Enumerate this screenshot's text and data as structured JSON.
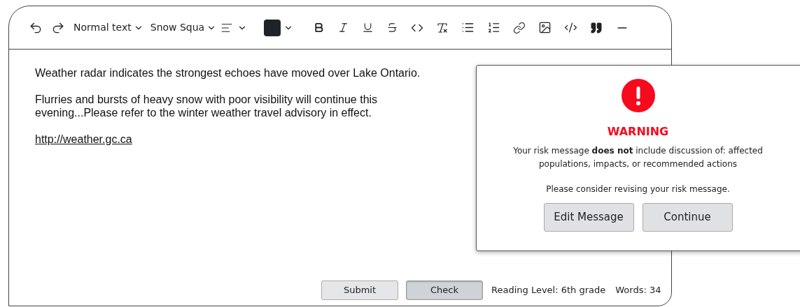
{
  "toolbar": {
    "style_select": "Normal text",
    "font_select": "Snow Squa",
    "color": "#1f2328"
  },
  "editor": {
    "paragraphs": [
      "Weather radar indicates the strongest echoes have moved over Lake Ontario.",
      "Flurries and bursts of heavy snow with poor visibility will continue this evening...Please refer to the winter weather travel advisory in effect."
    ],
    "link": "http://weather.gc.ca"
  },
  "footer": {
    "buttons": [
      {
        "label": "Submit",
        "pressed": false
      },
      {
        "label": "Check",
        "pressed": true
      }
    ],
    "reading_level": "Reading Level: 6th grade",
    "word_count": "Words: 34"
  },
  "dialog": {
    "title": "WARNING",
    "message": "Your risk message **does not** include discussion of: affected populations, impacts, or recommended actions",
    "note": "Please consider revising your risk message.",
    "buttons": [
      "Edit Message",
      "Continue"
    ]
  }
}
